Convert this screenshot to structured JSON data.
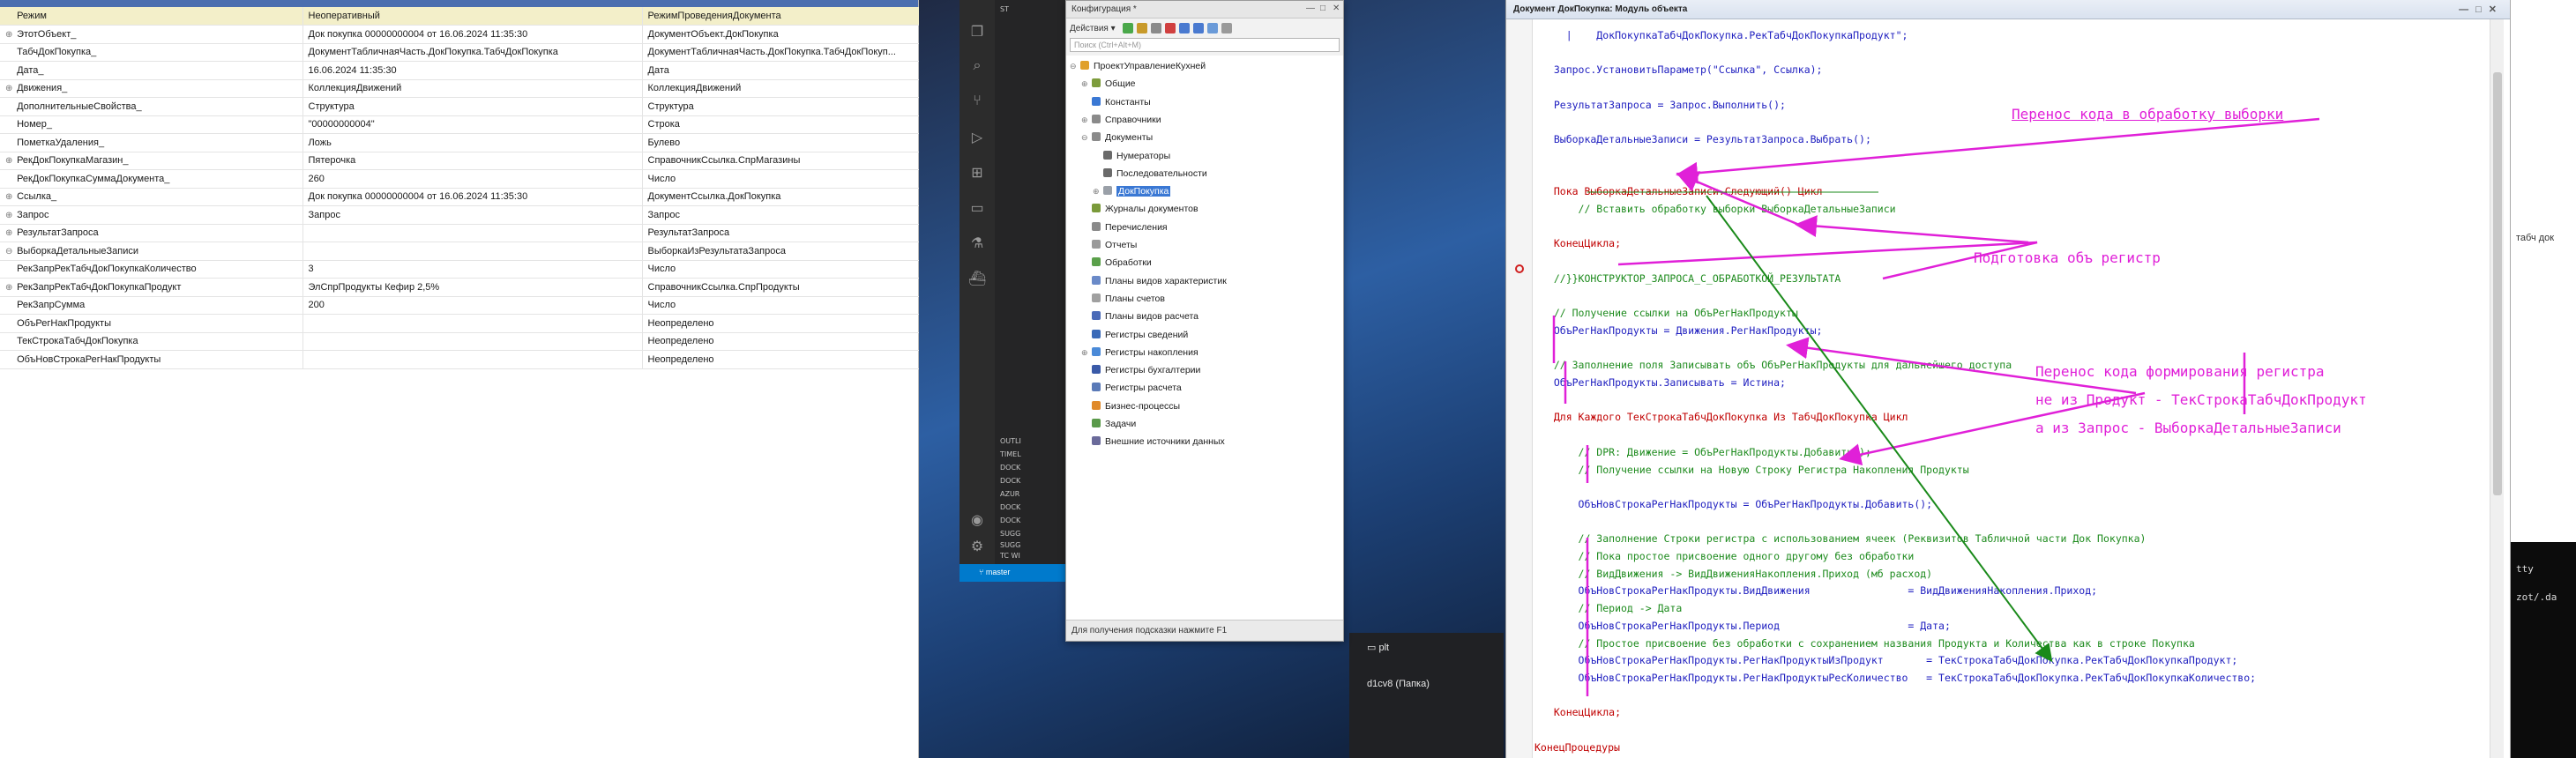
{
  "debug_rows": [
    {
      "expand": "",
      "name": "Режим",
      "value": "Неоперативный",
      "type": "РежимПроведенияДокумента"
    },
    {
      "expand": "⊕",
      "name": "ЭтотОбъект_",
      "value": "Док покупка 00000000004 от 16.06.2024 11:35:30",
      "type": "ДокументОбъект.ДокПокупка"
    },
    {
      "expand": "",
      "name": "ТабчДокПокупка_",
      "value": "ДокументТабличнаяЧасть.ДокПокупка.ТабчДокПокупка",
      "type": "ДокументТабличнаяЧасть.ДокПокупка.ТабчДокПокуп..."
    },
    {
      "expand": "",
      "name": "Дата_",
      "value": "16.06.2024 11:35:30",
      "type": "Дата"
    },
    {
      "expand": "⊕",
      "name": "Движения_",
      "value": "КоллекцияДвижений",
      "type": "КоллекцияДвижений"
    },
    {
      "expand": "",
      "name": "ДополнительныеСвойства_",
      "value": "Структура",
      "type": "Структура"
    },
    {
      "expand": "",
      "name": "Номер_",
      "value": "\"00000000004\"",
      "type": "Строка"
    },
    {
      "expand": "",
      "name": "ПометкаУдаления_",
      "value": "Ложь",
      "type": "Булево"
    },
    {
      "expand": "⊕",
      "name": "РекДокПокупкаМагазин_",
      "value": "Пятерочка",
      "type": "СправочникСсылка.СпрМагазины"
    },
    {
      "expand": "",
      "name": "РекДокПокупкаСуммаДокумента_",
      "value": "260",
      "type": "Число"
    },
    {
      "expand": "⊕",
      "name": "Ссылка_",
      "value": "Док покупка 00000000004 от 16.06.2024 11:35:30",
      "type": "ДокументСсылка.ДокПокупка"
    },
    {
      "expand": "⊕",
      "name": "Запрос",
      "value": "Запрос",
      "type": "Запрос"
    },
    {
      "expand": "⊕",
      "name": "РезультатЗапроса",
      "value": "",
      "type": "РезультатЗапроса"
    },
    {
      "expand": "⊖",
      "name": "ВыборкаДетальныеЗаписи",
      "value": "",
      "type": "ВыборкаИзРезультатаЗапроса"
    },
    {
      "expand": "",
      "name": "    РекЗапрРекТабчДокПокупкаКоличество",
      "value": "3",
      "type": "Число"
    },
    {
      "expand": "  ⊕",
      "name": "РекЗапрРекТабчДокПокупкаПродукт",
      "value": "ЭлСпрПродукты Кефир 2,5%",
      "type": "СправочникСсылка.СпрПродукты"
    },
    {
      "expand": "",
      "name": "    РекЗапрСумма",
      "value": "200",
      "type": "Число"
    },
    {
      "expand": "",
      "name": "ОбъРегНакПродукты",
      "value": "",
      "type": "Неопределено"
    },
    {
      "expand": "",
      "name": "ТекСтрокаТабчДокПокупка",
      "value": "",
      "type": "Неопределено"
    },
    {
      "expand": "",
      "name": "ОбъНовСтрокаРегНакПродукты",
      "value": "",
      "type": "Неопределено"
    }
  ],
  "vscode": {
    "side_rows": [
      "ST",
      "OUTLI",
      "TIMEL",
      "DOCK",
      "DOCK",
      "AZUR",
      "DOCK",
      "DOCK",
      "SUGG",
      "SUGG",
      "TC WI"
    ],
    "branch": "master"
  },
  "taskbar": {
    "items": [
      "plt",
      "d1cv8 (Папка)"
    ]
  },
  "config": {
    "title": "Конфигурация *",
    "actions_label": "Действия ▾",
    "search_placeholder": "Поиск (Ctrl+Alt+M)",
    "tree": [
      {
        "label": "ПроектУправлениеКухней",
        "depth": 0,
        "pm": "⊖",
        "color": "#e0a02a",
        "selected": false
      },
      {
        "label": "Общие",
        "depth": 1,
        "pm": "⊕",
        "color": "#7d9c3c",
        "selected": false
      },
      {
        "label": "Константы",
        "depth": 1,
        "pm": "",
        "color": "#3a78d4",
        "selected": false
      },
      {
        "label": "Справочники",
        "depth": 1,
        "pm": "⊕",
        "color": "#8a8a8a",
        "selected": false
      },
      {
        "label": "Документы",
        "depth": 1,
        "pm": "⊖",
        "color": "#8a8a8a",
        "selected": false
      },
      {
        "label": "Нумераторы",
        "depth": 2,
        "pm": "",
        "color": "#6a6a6a",
        "selected": false
      },
      {
        "label": "Последовательности",
        "depth": 2,
        "pm": "",
        "color": "#6a6a6a",
        "selected": false
      },
      {
        "label": "ДокПокупка",
        "depth": 2,
        "pm": "⊕",
        "color": "#9aa0a8",
        "selected": true
      },
      {
        "label": "Журналы документов",
        "depth": 1,
        "pm": "",
        "color": "#7a9a3a",
        "selected": false
      },
      {
        "label": "Перечисления",
        "depth": 1,
        "pm": "",
        "color": "#8a8a8a",
        "selected": false
      },
      {
        "label": "Отчеты",
        "depth": 1,
        "pm": "",
        "color": "#9a9a9a",
        "selected": false
      },
      {
        "label": "Обработки",
        "depth": 1,
        "pm": "",
        "color": "#5aa04a",
        "selected": false
      },
      {
        "label": "Планы видов характеристик",
        "depth": 1,
        "pm": "",
        "color": "#6a8ac8",
        "selected": false
      },
      {
        "label": "Планы счетов",
        "depth": 1,
        "pm": "",
        "color": "#a0a0a0",
        "selected": false
      },
      {
        "label": "Планы видов расчета",
        "depth": 1,
        "pm": "",
        "color": "#4a6ab8",
        "selected": false
      },
      {
        "label": "Регистры сведений",
        "depth": 1,
        "pm": "",
        "color": "#3a6ab8",
        "selected": false
      },
      {
        "label": "Регистры накопления",
        "depth": 1,
        "pm": "⊕",
        "color": "#4a8ad8",
        "selected": false
      },
      {
        "label": "Регистры бухгалтерии",
        "depth": 1,
        "pm": "",
        "color": "#3a5aa8",
        "selected": false
      },
      {
        "label": "Регистры расчета",
        "depth": 1,
        "pm": "",
        "color": "#5a7ab8",
        "selected": false
      },
      {
        "label": "Бизнес-процессы",
        "depth": 1,
        "pm": "",
        "color": "#e08a2a",
        "selected": false
      },
      {
        "label": "Задачи",
        "depth": 1,
        "pm": "",
        "color": "#5a9a4a",
        "selected": false
      },
      {
        "label": "Внешние источники данных",
        "depth": 1,
        "pm": "",
        "color": "#6a6a9a",
        "selected": false
      }
    ],
    "status": "Для получения подсказки нажмите F1"
  },
  "module": {
    "title": "Документ ДокПокупка: Модуль объекта",
    "lines": [
      {
        "t": "    |    ДокПокупкаТабчДокПокупка.РекТабчДокПокупкаПродукт\";",
        "k": "code"
      },
      {
        "t": "",
        "k": "code"
      },
      {
        "t": "  Запрос.УстановитьПараметр(\"Ссылка\", Ссылка);",
        "k": "code"
      },
      {
        "t": "",
        "k": "code"
      },
      {
        "t": "  РезультатЗапроса = Запрос.Выполнить();",
        "k": "code"
      },
      {
        "t": "",
        "k": "code"
      },
      {
        "t": "  ВыборкаДетальныеЗаписи = РезультатЗапроса.Выбрать();",
        "k": "code"
      },
      {
        "t": "",
        "k": "code"
      },
      {
        "t": "",
        "k": "code"
      },
      {
        "t": "  Пока ВыборкаДетальныеЗаписи.Следующий() Цикл",
        "k": "kw"
      },
      {
        "t": "      // Вставить обработку выборки ВыборкаДетальныеЗаписи",
        "k": "cm"
      },
      {
        "t": "",
        "k": "code"
      },
      {
        "t": "  КонецЦикла;",
        "k": "kw"
      },
      {
        "t": "",
        "k": "code"
      },
      {
        "t": "  //}}КОНСТРУКТОР_ЗАПРОСА_С_ОБРАБОТКОЙ_РЕЗУЛЬТАТА",
        "k": "cm"
      },
      {
        "t": "",
        "k": "code"
      },
      {
        "t": "  // Получение ссылки на ОбъРегНакПродукты",
        "k": "cm"
      },
      {
        "t": "  ОбъРегНакПродукты = Движения.РегНакПродукты;",
        "k": "code"
      },
      {
        "t": "",
        "k": "code"
      },
      {
        "t": "  // Заполнение поля Записывать объ ОбъРегНакПродукты для дальнейшего доступа",
        "k": "cm"
      },
      {
        "t": "  ОбъРегНакПродукты.Записывать = Истина;",
        "k": "code"
      },
      {
        "t": "",
        "k": "code"
      },
      {
        "t": "  Для Каждого ТекСтрокаТабчДокПокупка Из ТабчДокПокупка Цикл",
        "k": "kw"
      },
      {
        "t": "",
        "k": "code"
      },
      {
        "t": "      // DPR: Движение = ОбъРегНакПродукты.Добавить();",
        "k": "cm"
      },
      {
        "t": "      // Получение ссылки на Новую Строку Регистра Накопления Продукты",
        "k": "cm"
      },
      {
        "t": "",
        "k": "code"
      },
      {
        "t": "      ОбъНовСтрокаРегНакПродукты = ОбъРегНакПродукты.Добавить();",
        "k": "code"
      },
      {
        "t": "",
        "k": "code"
      },
      {
        "t": "      // Заполнение Строки регистра с использованием ячеек (Реквизитов Табличной части Док Покупка)",
        "k": "cm"
      },
      {
        "t": "      // Пока простое присвоение одного другому без обработки",
        "k": "cm"
      },
      {
        "t": "      // ВидДвижения -> ВидДвиженияНакопления.Приход (мб расход)",
        "k": "cm"
      },
      {
        "t": "      ОбъНовСтрокаРегНакПродукты.ВидДвижения                = ВидДвиженияНакопления.Приход;",
        "k": "code"
      },
      {
        "t": "      // Период -> Дата",
        "k": "cm"
      },
      {
        "t": "      ОбъНовСтрокаРегНакПродукты.Период                     = Дата;",
        "k": "code"
      },
      {
        "t": "      // Простое присвоение без обработки с сохранением названия Продукта и Количества как в строке Покупка",
        "k": "cm"
      },
      {
        "t": "      ОбъНовСтрокаРегНакПродукты.РегНакПродуктыИзПродукт       = ТекСтрокаТабчДокПокупка.РекТабчДокПокупкаПродукт;",
        "k": "code"
      },
      {
        "t": "      ОбъНовСтрокаРегНакПродукты.РегНакПродуктыРесКоличество   = ТекСтрокаТабчДокПокупка.РекТабчДокПокупкаКоличество;",
        "k": "code"
      },
      {
        "t": "",
        "k": "code"
      },
      {
        "t": "  КонецЦикла;",
        "k": "kw"
      },
      {
        "t": "",
        "k": "code"
      },
      {
        "t": "КонецПроцедуры",
        "k": "kw"
      }
    ],
    "annotations": [
      "Перенос кода в обработку выборки",
      "Подготовка объ регистр",
      "Перенос кода формирования регистра",
      "не из Продукт - ТекСтрокаТабчДокПродукт",
      "а из Запрос - ВыборкаДетальныеЗаписи"
    ]
  },
  "right_pane": {
    "texts": [
      "табч док",
      "tty",
      "zot/.da"
    ]
  }
}
